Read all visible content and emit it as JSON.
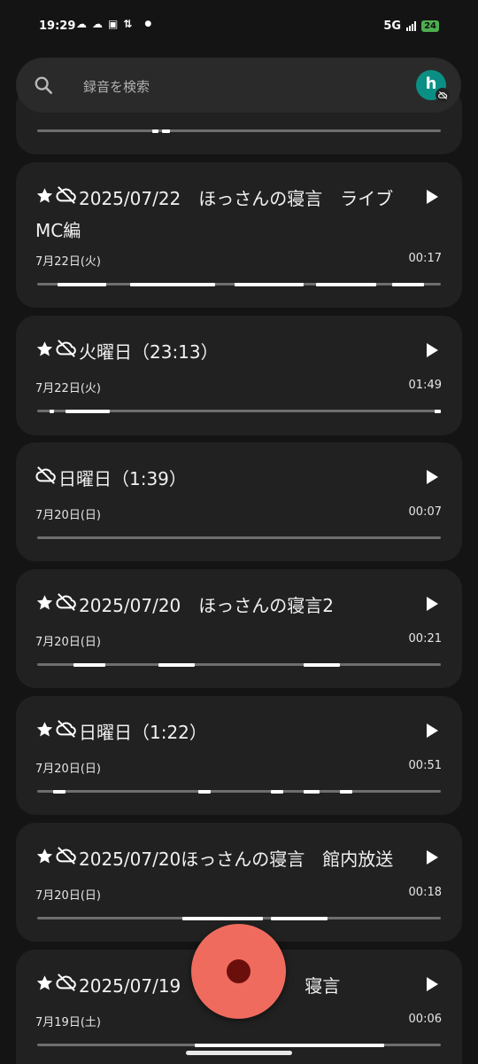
{
  "status_bar": {
    "time": "19:29",
    "network": "5G",
    "battery": "24",
    "notification_icons": [
      "cloud-icon",
      "cloud-icon",
      "android-icon",
      "network-icon",
      "dot-icon"
    ]
  },
  "search": {
    "placeholder": "録音を検索",
    "avatar_letter": "h"
  },
  "recordings": [
    {
      "title": "",
      "starred": false,
      "cloud_off": false,
      "date": "",
      "duration": "",
      "partial": true,
      "waveform_highlights": [
        [
          0.285,
          0.3
        ],
        [
          0.31,
          0.33
        ]
      ]
    },
    {
      "title": "2025/07/22　ほっさんの寝言　ライブMC編",
      "starred": true,
      "cloud_off": true,
      "date": "7月22日(火)",
      "duration": "00:17",
      "waveform_highlights": [
        [
          0.05,
          0.17
        ],
        [
          0.23,
          0.44
        ],
        [
          0.49,
          0.66
        ],
        [
          0.69,
          0.84
        ],
        [
          0.88,
          0.96
        ]
      ]
    },
    {
      "title": "火曜日（23:13）",
      "starred": true,
      "cloud_off": true,
      "date": "7月22日(火)",
      "duration": "01:49",
      "waveform_highlights": [
        [
          0.03,
          0.04
        ],
        [
          0.07,
          0.18
        ],
        [
          0.985,
          1.0
        ]
      ]
    },
    {
      "title": "日曜日（1:39）",
      "starred": false,
      "cloud_off": true,
      "date": "7月20日(日)",
      "duration": "00:07",
      "waveform_highlights": []
    },
    {
      "title": "2025/07/20　ほっさんの寝言2",
      "starred": true,
      "cloud_off": true,
      "date": "7月20日(日)",
      "duration": "00:21",
      "waveform_highlights": [
        [
          0.09,
          0.17
        ],
        [
          0.3,
          0.39
        ],
        [
          0.66,
          0.75
        ]
      ]
    },
    {
      "title": "日曜日（1:22）",
      "starred": true,
      "cloud_off": true,
      "date": "7月20日(日)",
      "duration": "00:51",
      "waveform_highlights": [
        [
          0.04,
          0.07
        ],
        [
          0.4,
          0.43
        ],
        [
          0.58,
          0.61
        ],
        [
          0.66,
          0.7
        ],
        [
          0.75,
          0.78
        ]
      ]
    },
    {
      "title": "2025/07/20ほっさんの寝言　館内放送",
      "starred": true,
      "cloud_off": true,
      "date": "7月20日(日)",
      "duration": "00:18",
      "waveform_highlights": [
        [
          0.36,
          0.56
        ],
        [
          0.58,
          0.72
        ]
      ]
    },
    {
      "title": "2025/07/19　　　　　　　寝言",
      "starred": true,
      "cloud_off": true,
      "date": "7月19日(土)",
      "duration": "00:06",
      "waveform_highlights": [
        [
          0.39,
          0.86
        ]
      ]
    }
  ]
}
